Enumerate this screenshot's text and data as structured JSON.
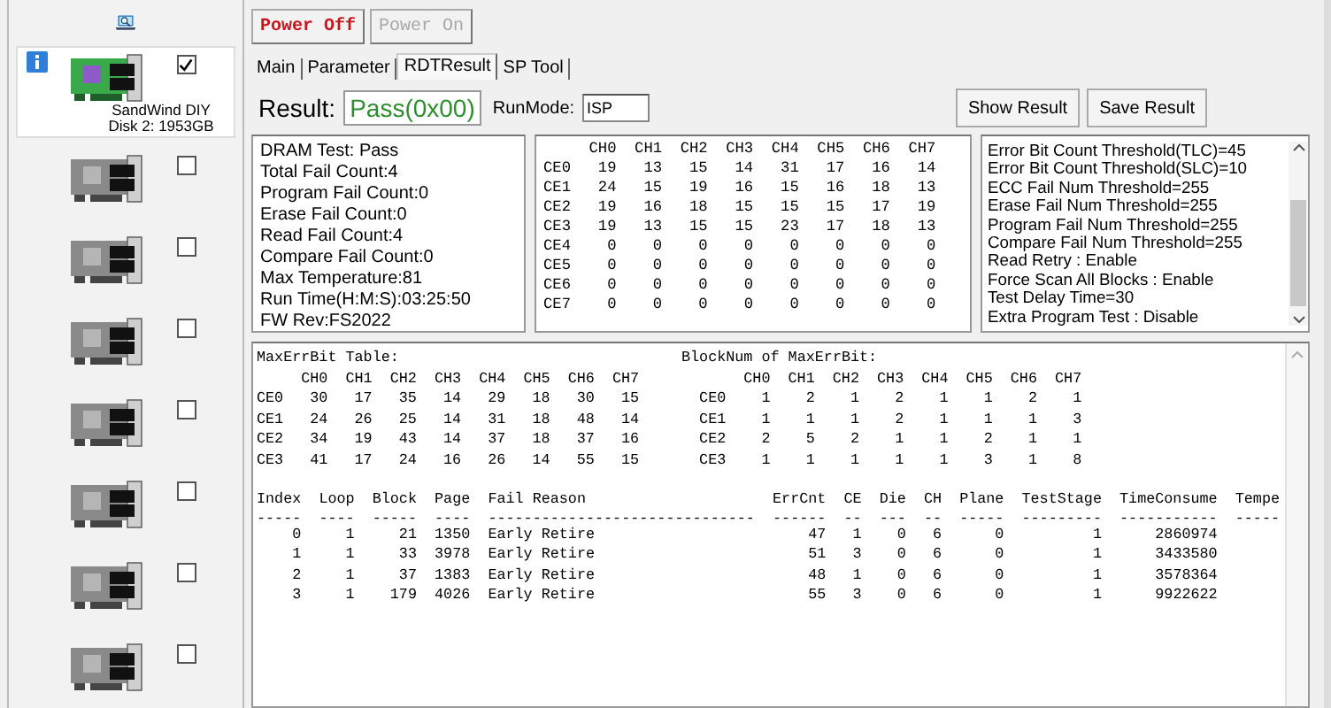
{
  "disks": [
    {
      "kind": "active",
      "selected": true,
      "checked": true,
      "name": "SandWind DIY",
      "detail": "Disk 2: 1953GB"
    },
    {
      "kind": "empty",
      "selected": false,
      "checked": false
    },
    {
      "kind": "empty",
      "selected": false,
      "checked": false
    },
    {
      "kind": "empty",
      "selected": false,
      "checked": false
    },
    {
      "kind": "empty",
      "selected": false,
      "checked": false
    },
    {
      "kind": "empty",
      "selected": false,
      "checked": false
    },
    {
      "kind": "empty",
      "selected": false,
      "checked": false
    },
    {
      "kind": "empty",
      "selected": false,
      "checked": false
    }
  ],
  "power_buttons": [
    {
      "label": "Power Off",
      "disabled": false
    },
    {
      "label": "Power On",
      "disabled": true
    }
  ],
  "tabs": [
    {
      "label": "Main",
      "selected": false
    },
    {
      "label": "Parameter",
      "selected": false
    },
    {
      "label": "RDTResult",
      "selected": true
    },
    {
      "label": "SP Tool",
      "selected": false
    }
  ],
  "result": {
    "label": "Result:",
    "value": "Pass(0x00)",
    "run_mode_label": "RunMode:",
    "run_mode": "ISP"
  },
  "buttons": [
    "Show Result",
    "Save Result"
  ],
  "summary": [
    "DRAM Test: Pass",
    "Total Fail Count:4",
    "Program Fail Count:0",
    "Erase Fail Count:0",
    "Read Fail Count:4",
    "Compare Fail Count:0",
    "Max Temperature:81",
    "Run Time(H:M:S):03:25:50",
    "FW Rev:FS2022"
  ],
  "fail_bit_table": {
    "columns": [
      "CH0",
      "CH1",
      "CH2",
      "CH3",
      "CH4",
      "CH5",
      "CH6",
      "CH7"
    ],
    "rows": [
      {
        "label": "CE0",
        "values": [
          "19",
          "13",
          "15",
          "14",
          "31",
          "17",
          "16",
          "14"
        ]
      },
      {
        "label": "CE1",
        "values": [
          "24",
          "15",
          "19",
          "16",
          "15",
          "16",
          "18",
          "13"
        ]
      },
      {
        "label": "CE2",
        "values": [
          "19",
          "16",
          "18",
          "15",
          "15",
          "15",
          "17",
          "19"
        ]
      },
      {
        "label": "CE3",
        "values": [
          "19",
          "13",
          "15",
          "15",
          "23",
          "17",
          "18",
          "13"
        ]
      },
      {
        "label": "CE4",
        "values": [
          "0",
          "0",
          "0",
          "0",
          "0",
          "0",
          "0",
          "0"
        ]
      },
      {
        "label": "CE5",
        "values": [
          "0",
          "0",
          "0",
          "0",
          "0",
          "0",
          "0",
          "0"
        ]
      },
      {
        "label": "CE6",
        "values": [
          "0",
          "0",
          "0",
          "0",
          "0",
          "0",
          "0",
          "0"
        ]
      },
      {
        "label": "CE7",
        "values": [
          "0",
          "0",
          "0",
          "0",
          "0",
          "0",
          "0",
          "0"
        ]
      }
    ]
  },
  "settings": [
    "Error Bit Count Threshold(TLC)=45",
    "Error Bit Count Threshold(SLC)=10",
    "ECC Fail Num Threshold=255",
    "Erase Fail Num Threshold=255",
    "Program Fail Num Threshold=255",
    "Compare Fail Num Threshold=255",
    "Read Retry : Enable",
    "Force Scan All Blocks : Enable",
    "Test Delay Time=30",
    "Extra Program Test : Disable"
  ],
  "max_err_bit": {
    "title": "MaxErrBit Table:",
    "columns": [
      "CH0",
      "CH1",
      "CH2",
      "CH3",
      "CH4",
      "CH5",
      "CH6",
      "CH7"
    ],
    "rows": [
      {
        "label": "CE0",
        "values": [
          "30",
          "17",
          "35",
          "14",
          "29",
          "18",
          "30",
          "15"
        ]
      },
      {
        "label": "CE1",
        "values": [
          "24",
          "26",
          "25",
          "14",
          "31",
          "18",
          "48",
          "14"
        ]
      },
      {
        "label": "CE2",
        "values": [
          "34",
          "19",
          "43",
          "14",
          "37",
          "18",
          "37",
          "16"
        ]
      },
      {
        "label": "CE3",
        "values": [
          "41",
          "17",
          "24",
          "16",
          "26",
          "14",
          "55",
          "15"
        ]
      }
    ]
  },
  "block_num": {
    "title": "BlockNum of MaxErrBit:",
    "columns": [
      "CH0",
      "CH1",
      "CH2",
      "CH3",
      "CH4",
      "CH5",
      "CH6",
      "CH7"
    ],
    "rows": [
      {
        "label": "CE0",
        "values": [
          "1",
          "2",
          "1",
          "2",
          "1",
          "1",
          "2",
          "1"
        ]
      },
      {
        "label": "CE1",
        "values": [
          "1",
          "1",
          "1",
          "2",
          "1",
          "1",
          "1",
          "3"
        ]
      },
      {
        "label": "CE2",
        "values": [
          "2",
          "5",
          "2",
          "1",
          "1",
          "2",
          "1",
          "1"
        ]
      },
      {
        "label": "CE3",
        "values": [
          "1",
          "1",
          "1",
          "1",
          "1",
          "3",
          "1",
          "8"
        ]
      }
    ]
  },
  "fail_log": {
    "columns": [
      {
        "header": "Index",
        "rule": "-----"
      },
      {
        "header": "Loop",
        "rule": "----"
      },
      {
        "header": "Block",
        "rule": "-----"
      },
      {
        "header": "Page",
        "rule": "----"
      },
      {
        "header": "Fail Reason",
        "rule": "------------------------------"
      },
      {
        "header": "ErrCnt",
        "rule": "------"
      },
      {
        "header": "CE",
        "rule": "--"
      },
      {
        "header": "Die",
        "rule": "---"
      },
      {
        "header": "CH",
        "rule": "--"
      },
      {
        "header": "Plane",
        "rule": "-----"
      },
      {
        "header": "TestStage",
        "rule": "---------"
      },
      {
        "header": "TimeConsume",
        "rule": "-----------"
      },
      {
        "header": "Tempe",
        "rule": "-----"
      }
    ],
    "rows": [
      [
        "0",
        "1",
        "21",
        "1350",
        "Early Retire",
        "47",
        "1",
        "0",
        "6",
        "0",
        "1",
        "2860974"
      ],
      [
        "1",
        "1",
        "33",
        "3978",
        "Early Retire",
        "51",
        "3",
        "0",
        "6",
        "0",
        "1",
        "3433580"
      ],
      [
        "2",
        "1",
        "37",
        "1383",
        "Early Retire",
        "48",
        "1",
        "0",
        "6",
        "0",
        "1",
        "3578364"
      ],
      [
        "3",
        "1",
        "179",
        "4026",
        "Early Retire",
        "55",
        "3",
        "0",
        "6",
        "0",
        "1",
        "9922622"
      ]
    ]
  }
}
